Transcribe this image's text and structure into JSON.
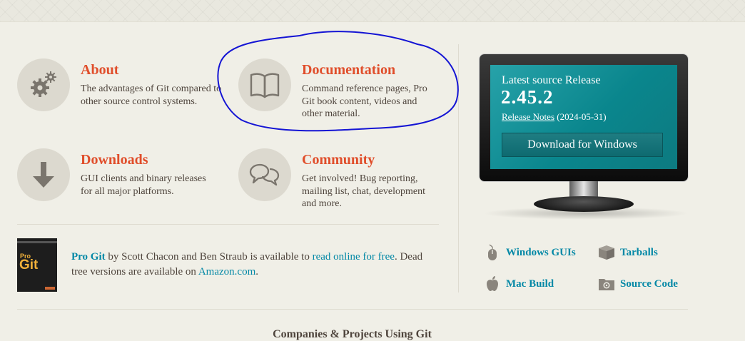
{
  "features": [
    {
      "key": "about",
      "icon": "gears-icon",
      "title": "About",
      "description": "The advantages of Git compared to other source control systems."
    },
    {
      "key": "documentation",
      "icon": "book-icon",
      "title": "Documentation",
      "description": "Command reference pages, Pro Git book content, videos and other material."
    },
    {
      "key": "downloads",
      "icon": "download-arrow-icon",
      "title": "Downloads",
      "description": "GUI clients and binary releases for all major platforms."
    },
    {
      "key": "community",
      "icon": "chat-bubbles-icon",
      "title": "Community",
      "description": "Get involved! Bug reporting, mailing list, chat, development and more."
    }
  ],
  "progit": {
    "cover_small": "Pro",
    "cover_large": "Git",
    "book_title": "Pro Git",
    "text_1": " by Scott Chacon and Ben Straub is available to ",
    "read_link": "read online for free",
    "text_2": ". Dead tree versions are available on ",
    "amazon_link": "Amazon.com",
    "text_3": "."
  },
  "release": {
    "heading": "Latest source Release",
    "version": "2.45.2",
    "notes_label": "Release Notes",
    "date": "(2024-05-31)",
    "download_button": "Download for Windows"
  },
  "download_links": [
    {
      "label": "Windows GUIs",
      "icon": "mouse-icon"
    },
    {
      "label": "Tarballs",
      "icon": "package-box-icon"
    },
    {
      "label": "Mac Build",
      "icon": "apple-icon"
    },
    {
      "label": "Source Code",
      "icon": "folder-gear-icon"
    }
  ],
  "companies_heading": "Companies & Projects Using Git",
  "colors": {
    "accent_orange": "#e04e2b",
    "link_blue": "#0388a6",
    "screen_teal": "#0a868d",
    "background": "#f0efe7",
    "annotation_blue": "#1414d4"
  }
}
